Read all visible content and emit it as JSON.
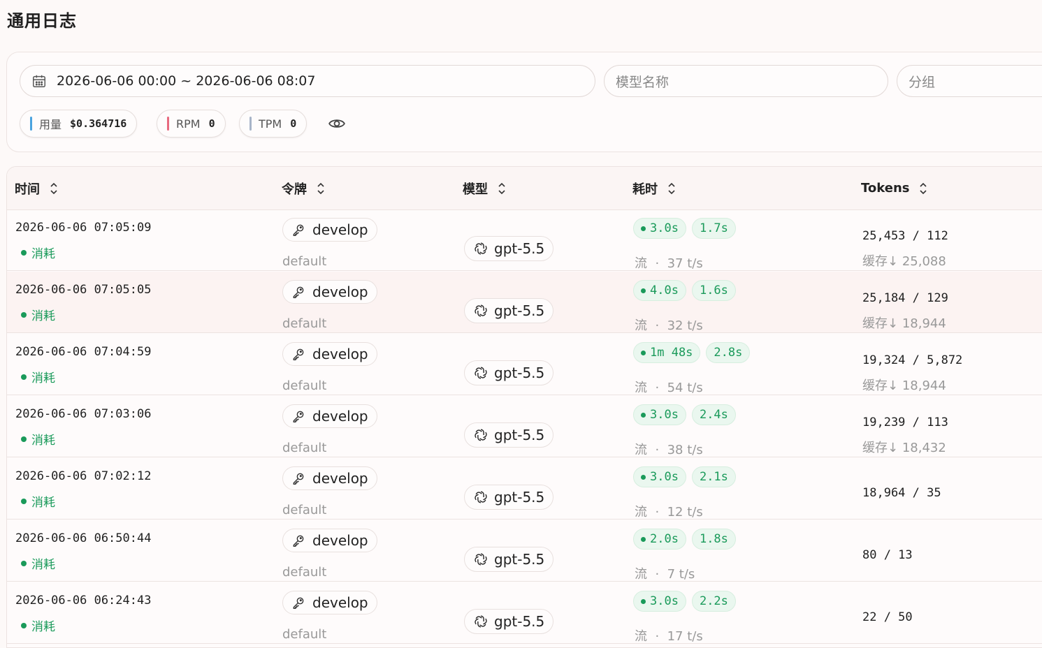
{
  "page_title": "通用日志",
  "filters": {
    "date_range": "2026-06-06 00:00 ~ 2026-06-06 08:07",
    "model_placeholder": "模型名称",
    "group_placeholder": "分组"
  },
  "stats": {
    "usage_label": "用量",
    "usage_value": "$0.364716",
    "rpm_label": "RPM",
    "rpm_value": "0",
    "tpm_label": "TPM",
    "tpm_value": "0",
    "colors": {
      "usage": "#4aa3df",
      "rpm": "#e86a7f",
      "tpm": "#a7b4c8"
    }
  },
  "table": {
    "headers": [
      "时间",
      "令牌",
      "模型",
      "耗时",
      "Tokens"
    ],
    "rows": [
      {
        "time": "2026-06-06 07:05:09",
        "status": "消耗",
        "token": "develop",
        "group": "default",
        "model": "gpt-5.5",
        "total": "3.0s",
        "first": "1.7s",
        "speed_label": "流",
        "speed": "37 t/s",
        "tokens": "25,453 / 112",
        "cache_label": "缓存↓",
        "cache": "25,088"
      },
      {
        "time": "2026-06-06 07:05:05",
        "status": "消耗",
        "token": "develop",
        "group": "default",
        "model": "gpt-5.5",
        "total": "4.0s",
        "first": "1.6s",
        "speed_label": "流",
        "speed": "32 t/s",
        "tokens": "25,184 / 129",
        "cache_label": "缓存↓",
        "cache": "18,944"
      },
      {
        "time": "2026-06-06 07:04:59",
        "status": "消耗",
        "token": "develop",
        "group": "default",
        "model": "gpt-5.5",
        "total": "1m 48s",
        "first": "2.8s",
        "speed_label": "流",
        "speed": "54 t/s",
        "tokens": "19,324 / 5,872",
        "cache_label": "缓存↓",
        "cache": "18,944"
      },
      {
        "time": "2026-06-06 07:03:06",
        "status": "消耗",
        "token": "develop",
        "group": "default",
        "model": "gpt-5.5",
        "total": "3.0s",
        "first": "2.4s",
        "speed_label": "流",
        "speed": "38 t/s",
        "tokens": "19,239 / 113",
        "cache_label": "缓存↓",
        "cache": "18,432"
      },
      {
        "time": "2026-06-06 07:02:12",
        "status": "消耗",
        "token": "develop",
        "group": "default",
        "model": "gpt-5.5",
        "total": "3.0s",
        "first": "2.1s",
        "speed_label": "流",
        "speed": "12 t/s",
        "tokens": "18,964 / 35",
        "cache_label": "",
        "cache": ""
      },
      {
        "time": "2026-06-06 06:50:44",
        "status": "消耗",
        "token": "develop",
        "group": "default",
        "model": "gpt-5.5",
        "total": "2.0s",
        "first": "1.8s",
        "speed_label": "流",
        "speed": "7 t/s",
        "tokens": "80 / 13",
        "cache_label": "",
        "cache": ""
      },
      {
        "time": "2026-06-06 06:24:43",
        "status": "消耗",
        "token": "develop",
        "group": "default",
        "model": "gpt-5.5",
        "total": "3.0s",
        "first": "2.2s",
        "speed_label": "流",
        "speed": "17 t/s",
        "tokens": "22 / 50",
        "cache_label": "",
        "cache": ""
      }
    ]
  },
  "icons": {
    "calendar": "calendar-icon",
    "eye": "eye-icon",
    "sort": "sort-icon",
    "key": "key-icon",
    "model": "openai-icon"
  }
}
